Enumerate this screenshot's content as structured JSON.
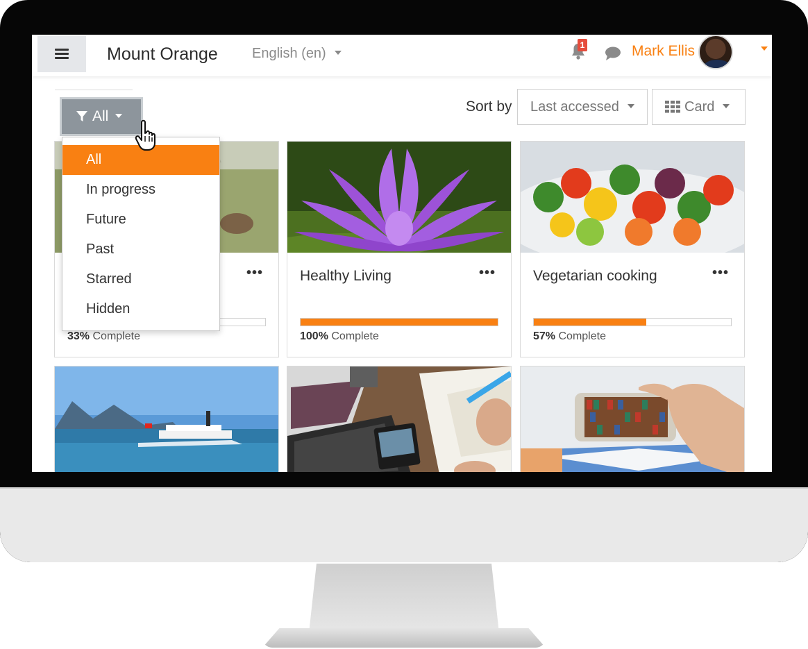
{
  "navbar": {
    "site_name": "Mount Orange",
    "language": "English (en)",
    "notification_count": "1",
    "user_name": "Mark Ellis"
  },
  "filter": {
    "label": "All",
    "options": [
      "All",
      "In progress",
      "Future",
      "Past",
      "Starred",
      "Hidden"
    ],
    "selected": "All"
  },
  "sort": {
    "label": "Sort by",
    "selected": "Last accessed",
    "view": "Card"
  },
  "courses": [
    {
      "title": "",
      "progress_pct": "33%",
      "progress_value": 0.33,
      "progress_suffix": "Complete",
      "image": "landscape"
    },
    {
      "title": "Healthy Living",
      "progress_pct": "100%",
      "progress_value": 1.0,
      "progress_suffix": "Complete",
      "image": "lotus-flower"
    },
    {
      "title": "Vegetarian cooking",
      "progress_pct": "57%",
      "progress_value": 0.57,
      "progress_suffix": "Complete",
      "image": "vegetable-skewers"
    },
    {
      "title": "",
      "image": "lake-steamboat"
    },
    {
      "title": "",
      "image": "laptop-desk"
    },
    {
      "title": "",
      "image": "phone-bookshelf"
    }
  ],
  "colors": {
    "accent": "#f98012",
    "filter_button": "#8d959c",
    "frame": "#060606"
  }
}
